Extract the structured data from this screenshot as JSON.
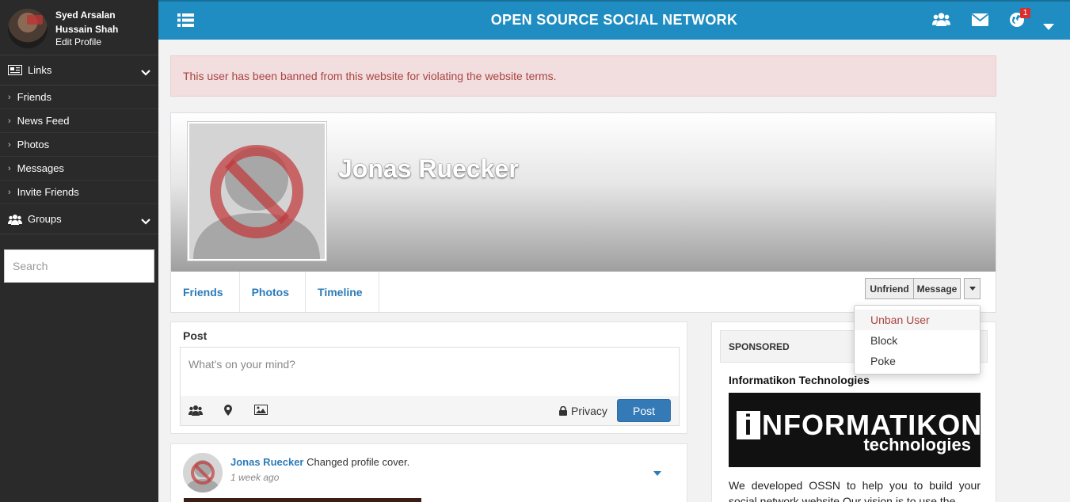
{
  "sidebar": {
    "user_name": "Syed Arsalan Hussain Shah",
    "edit_profile": "Edit Profile",
    "links_label": "Links",
    "items": [
      "Friends",
      "News Feed",
      "Photos",
      "Messages",
      "Invite Friends"
    ],
    "groups_label": "Groups",
    "search_placeholder": "Search"
  },
  "topbar": {
    "title": "OPEN SOURCE SOCIAL NETWORK",
    "notification_count": "1"
  },
  "alert": {
    "message": "This user has been banned from this website for violating the website terms."
  },
  "profile": {
    "name": "Jonas Ruecker",
    "tabs": [
      "Friends",
      "Photos",
      "Timeline"
    ],
    "unfriend_label": "Unfriend",
    "message_label": "Message"
  },
  "dropdown": {
    "items": [
      "Unban User",
      "Block",
      "Poke"
    ]
  },
  "post": {
    "title": "Post",
    "placeholder": "What's on your mind?",
    "privacy_label": "Privacy",
    "post_label": "Post"
  },
  "activity": {
    "user": "Jonas Ruecker",
    "action": " Changed profile cover.",
    "time": "1 week ago"
  },
  "sponsored": {
    "heading": "SPONSORED",
    "title": "Informatikon Technologies",
    "logo_main": "NFORMATIKON",
    "logo_letter": "i",
    "logo_sub": "technologies",
    "text": "We developed OSSN to help you to build your social network website.Our vision is to use the"
  },
  "colors": {
    "topbar": "#1f8dc1",
    "sidebar": "#2a2a2a",
    "link": "#2b7bb9",
    "alert_bg": "#f2dede",
    "alert_text": "#a94442",
    "primary_button": "#337ab7"
  }
}
